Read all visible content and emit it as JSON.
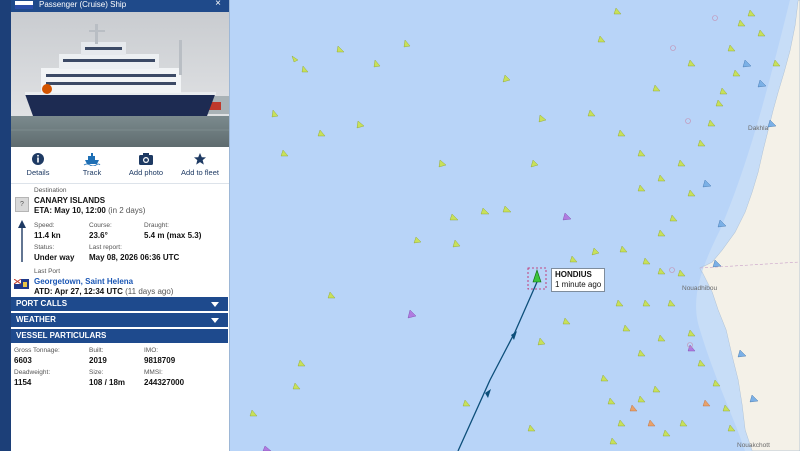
{
  "header": {
    "vessel_type": "Passenger (Cruise) Ship",
    "close": "×"
  },
  "actions": [
    {
      "label": "Details",
      "icon": "info-icon"
    },
    {
      "label": "Track",
      "icon": "ship-icon"
    },
    {
      "label": "Add photo",
      "icon": "camera-icon"
    },
    {
      "label": "Add to fleet",
      "icon": "star-icon"
    }
  ],
  "voyage": {
    "dest_label": "Destination",
    "dest_placeholder_icon": "?",
    "destination": "CANARY ISLANDS",
    "eta": "ETA: May 10, 12:00",
    "eta_note": "(in 2 days)",
    "speed_label": "Speed:",
    "speed": "11.4 kn",
    "course_label": "Course:",
    "course": "23.6°",
    "draught_label": "Draught:",
    "draught": "5.4 m (max 5.3)",
    "status_label": "Status:",
    "status": "Under way",
    "report_label": "Last report:",
    "report": "May 08, 2026 06:36 UTC",
    "lastport_label": "Last Port",
    "lastport": "Georgetown, Saint Helena",
    "atd": "ATD: Apr 27, 12:34 UTC",
    "atd_note": "(11 days ago)"
  },
  "sections": {
    "port_calls": "PORT CALLS",
    "weather": "WEATHER",
    "particulars": "VESSEL PARTICULARS"
  },
  "particulars": {
    "gt_label": "Gross Tonnage:",
    "gt": "6603",
    "built_label": "Built:",
    "built": "2019",
    "imo_label": "IMO:",
    "imo": "9818709",
    "dwt_label": "Deadweight:",
    "dwt": "1154",
    "size_label": "Size:",
    "size": "108 / 18m",
    "mmsi_label": "MMSI:",
    "mmsi": "244327000"
  },
  "map": {
    "vessel_name": "HONDIUS",
    "vessel_time": "1 minute ago",
    "places": [
      "Dakhla",
      "Nouadhibou",
      "Nouakchott"
    ]
  },
  "colors": {
    "panel_blue": "#1e4a8d",
    "sea": "#b8d4f8",
    "land": "#f4f1e8",
    "track": "#0d4f7a",
    "vessel": "#3cc43c"
  }
}
